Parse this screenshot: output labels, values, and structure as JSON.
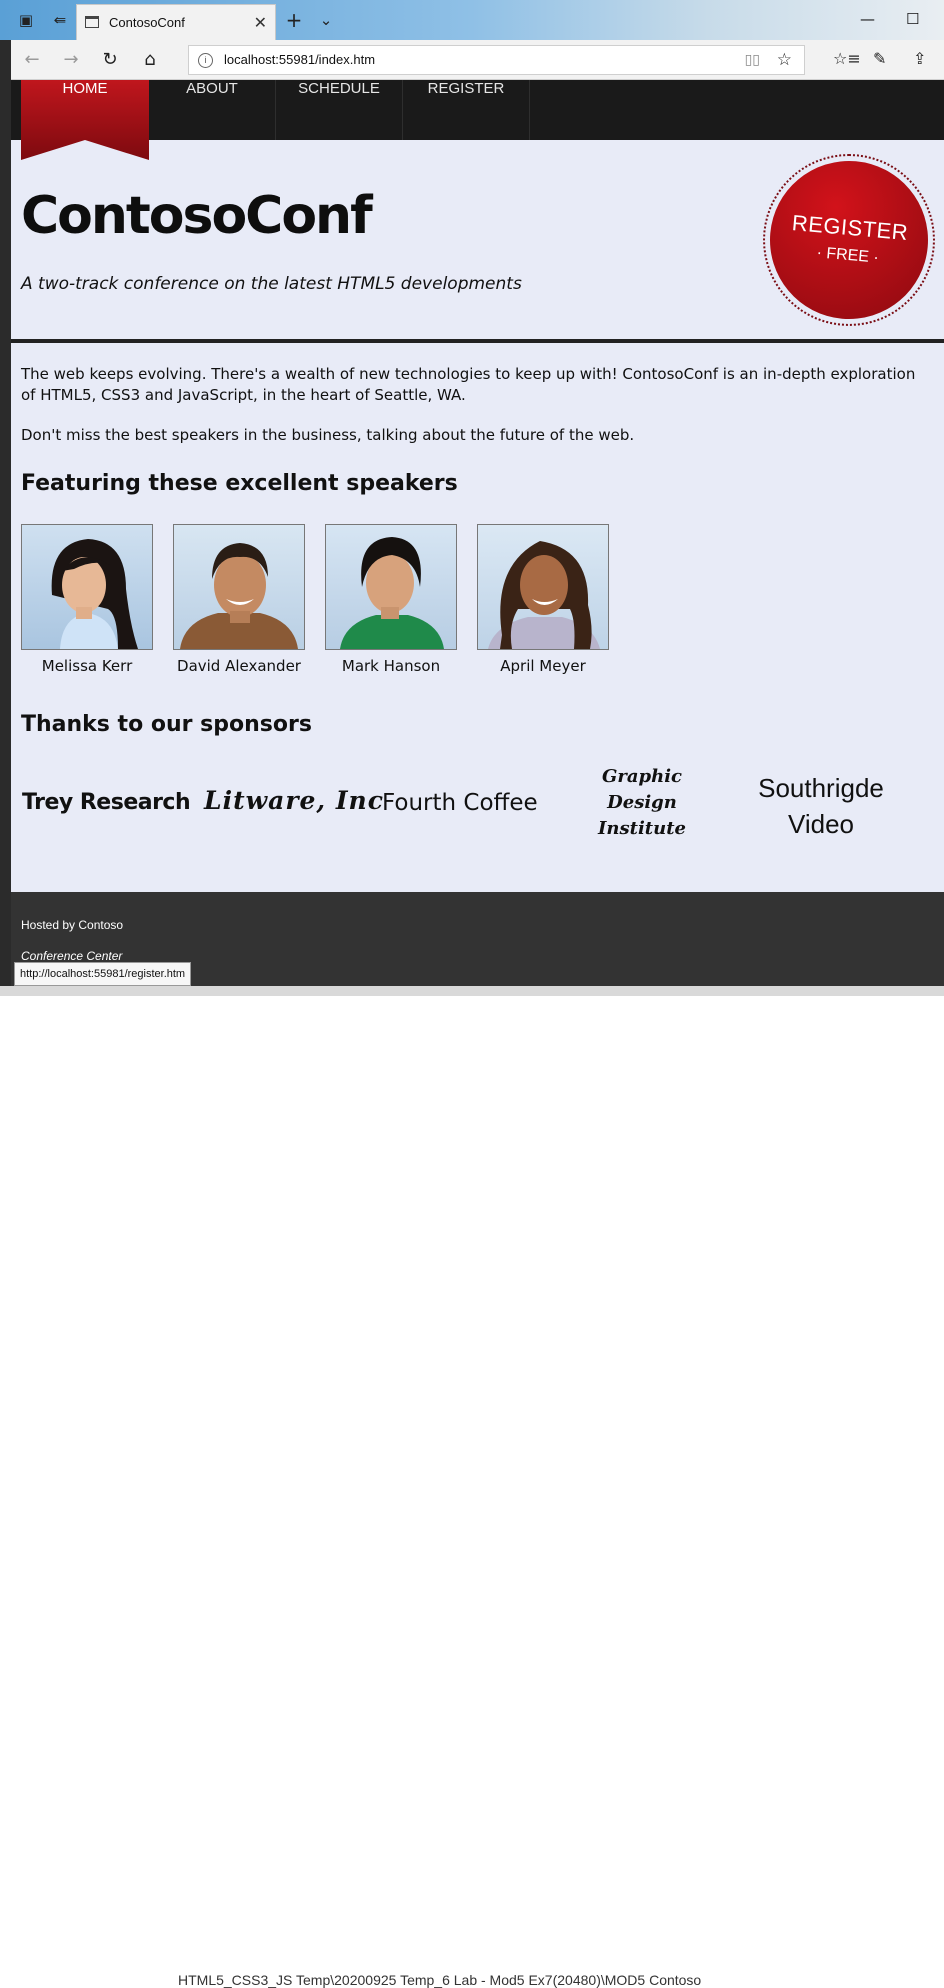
{
  "browser": {
    "tab_title": "ContosoConf",
    "url": "localhost:55981/index.htm",
    "status_url": "http://localhost:55981/register.htm",
    "background_text": "HTML5_CSS3_JS Temp\\20200925 Temp_6 Lab - Mod5 Ex7(20480)\\MOD5 Contoso"
  },
  "nav": {
    "items": [
      {
        "label": "HOME",
        "active": true
      },
      {
        "label": "ABOUT"
      },
      {
        "label": "SCHEDULE"
      },
      {
        "label": "REGISTER"
      }
    ]
  },
  "header": {
    "title": "ContosoConf",
    "tagline": "A two-track conference on the latest HTML5 developments",
    "badge_main": "REGISTER",
    "badge_sub": "· FREE ·"
  },
  "intro": {
    "p1": "The web keeps evolving. There's a wealth of new technologies to keep up with! ContosoConf is an in-depth exploration of HTML5, CSS3 and JavaScript, in the heart of Seattle, WA.",
    "p2": "Don't miss the best speakers in the business, talking about the future of the web."
  },
  "speakers": {
    "heading": "Featuring these excellent speakers",
    "list": [
      {
        "name": "Melissa Kerr"
      },
      {
        "name": "David Alexander"
      },
      {
        "name": "Mark Hanson"
      },
      {
        "name": "April Meyer"
      }
    ]
  },
  "sponsors": {
    "heading": "Thanks to our sponsors",
    "list": [
      "Trey Research",
      "Litware, Inc",
      "Fourth Coffee",
      "Graphic Design Institute",
      "Southrigde Video"
    ]
  },
  "footer": {
    "hosted": "Hosted by Contoso",
    "venue": "Conference Center"
  },
  "colors": {
    "accent": "#b3131a",
    "nav_bg": "#1a1a1a",
    "page_bg": "#e8ebf7",
    "footer_bg": "#333333"
  }
}
